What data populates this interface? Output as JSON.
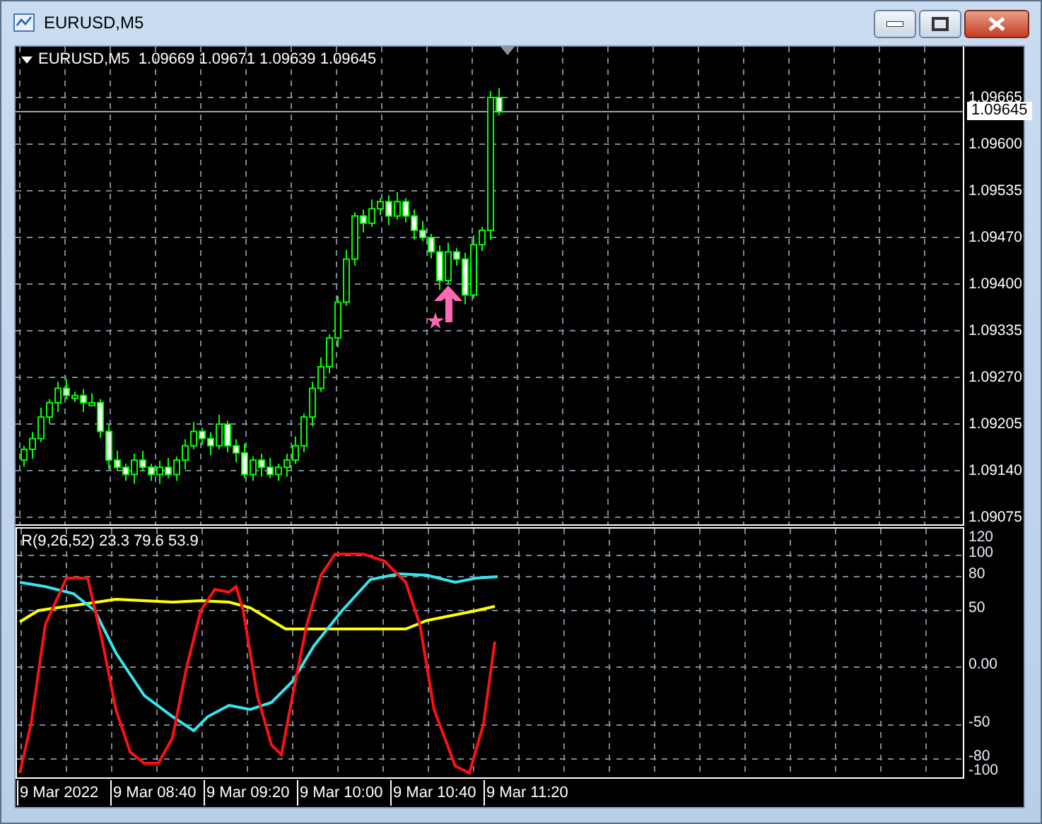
{
  "window": {
    "title": "EURUSD,M5"
  },
  "chart": {
    "header": "EURUSD,M5  1.09669 1.09671 1.09639 1.09645",
    "price_labels": [
      "1.09665",
      "1.09600",
      "1.09535",
      "1.09470",
      "1.09400",
      "1.09335",
      "1.09270",
      "1.09205",
      "1.09140",
      "1.09075"
    ],
    "current_price": "1.09645"
  },
  "indicator": {
    "label": "R(9,26,52) 23.3 79.6 53.9",
    "scale_labels": [
      "120",
      "100",
      "80",
      "50",
      "0.00",
      "-50",
      "-80",
      "-100"
    ]
  },
  "time_axis": [
    "9 Mar 2022",
    "9 Mar 08:40",
    "9 Mar 09:20",
    "9 Mar 10:00",
    "9 Mar 10:40",
    "9 Mar 11:20"
  ]
}
